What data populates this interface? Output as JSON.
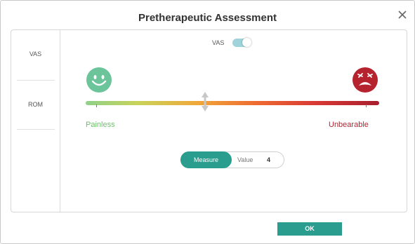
{
  "dialog": {
    "title": "Pretherapeutic Assessment",
    "ok_label": "OK"
  },
  "sidebar": {
    "items": [
      {
        "label": "VAS"
      },
      {
        "label": "ROM"
      }
    ]
  },
  "toggle": {
    "label": "VAS",
    "on": true
  },
  "scale": {
    "min_label": "Painless",
    "max_label": "Unbearable",
    "current_value": 4,
    "min_value": 0,
    "max_value": 10
  },
  "measure": {
    "button_label": "Measure",
    "value_label": "Value",
    "value": "4"
  },
  "icons": {
    "close": "close-icon",
    "min_face": "smiling-face-icon",
    "max_face": "crying-face-icon",
    "slider": "slider-thumb-icon"
  },
  "colors": {
    "accent": "#2a9d8f",
    "painless": "#6cc06a",
    "unbearable": "#b5232f",
    "toggle_on": "#9fd4da"
  }
}
